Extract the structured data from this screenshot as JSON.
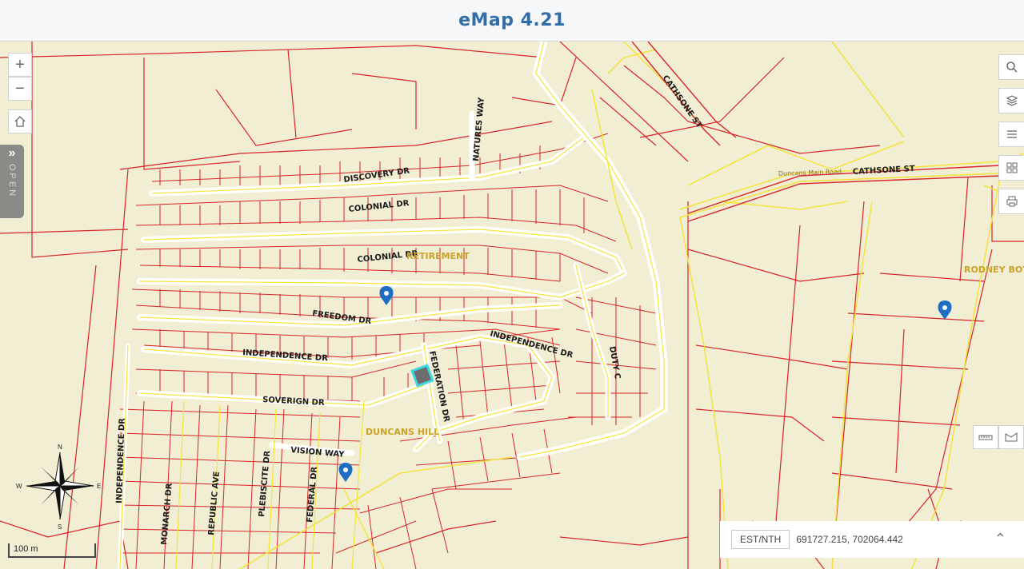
{
  "app": {
    "title": "eMap 4.21"
  },
  "controls": {
    "zoom_in": "+",
    "zoom_out": "−",
    "open_tab": "OPEN",
    "open_chevron": "»"
  },
  "streets": {
    "discovery": "DISCOVERY DR",
    "colonial_1": "COLONIAL DR",
    "colonial_2": "COLONIAL DR",
    "freedom": "FREEDOM  DR",
    "independence_1": "INDEPENDENCE DR",
    "independence_2": "INDEPENDENCE DR",
    "independence_3": "INDEPENDENCE DR",
    "soverign": "SOVERIGN DR",
    "vision": "VISION WAY",
    "federation": "FEDERATION DR",
    "natures": "NATURES WAY",
    "cathsone_1": "CATHSONE ST",
    "cathsone_2": "CATHSONE ST",
    "duncans_main": "Duncans Main Road",
    "duty": "DUTY C",
    "monarch": "MONARCH DR",
    "republic": "REPUBLIC AVE",
    "plebiscite": "PLEBISCITE DR",
    "federal": "FEDERAL DR"
  },
  "areas": {
    "retirement": "RETIREMENT",
    "duncans_hill": "DUNCANS HILL",
    "rodney": "RODNEY BOT"
  },
  "compass": {
    "n": "N",
    "s": "S",
    "w": "W",
    "e": "E"
  },
  "scale": {
    "label": "100 m"
  },
  "coords": {
    "system": "EST/NTH",
    "value": "691727.215, 702064.442"
  },
  "colors": {
    "parcel": "#d8242a",
    "road": "#f3e43a",
    "background": "#f2eed3",
    "marker": "#1e6fc4",
    "accent": "#2f6ea8"
  }
}
